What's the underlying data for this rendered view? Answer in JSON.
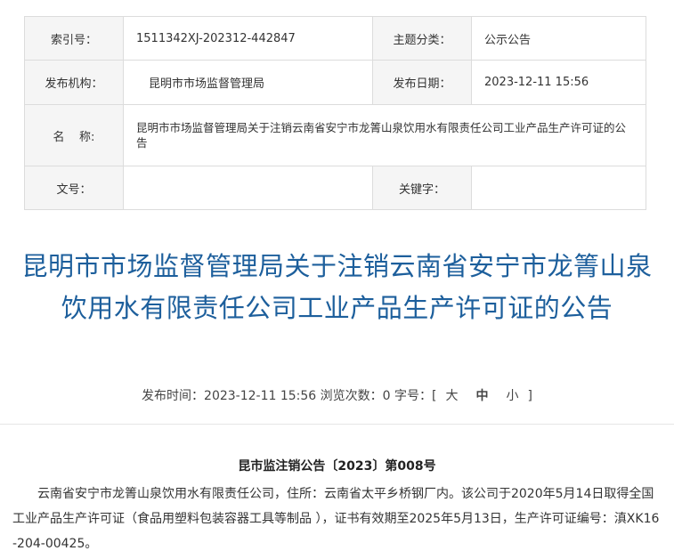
{
  "meta": {
    "index_label": "索引号：",
    "index_value": "1511342XJ-202312-442847",
    "category_label": "主题分类：",
    "category_value": "公示公告",
    "publisher_label": "发布机构：",
    "publisher_value": "昆明市市场监督管理局",
    "date_label": "发布日期：",
    "date_value": "2023-12-11 15:56",
    "name_label": "名    称:",
    "name_value": "昆明市市场监督管理局关于注销云南省安宁市龙箐山泉饮用水有限责任公司工业产品生产许可证的公告",
    "docno_label": "文号：",
    "docno_value": "",
    "keyword_label": "关键字：",
    "keyword_value": ""
  },
  "article": {
    "title": "昆明市市场监督管理局关于注销云南省安宁市龙箐山泉饮用水有限责任公司工业产品生产许可证的公告",
    "publish_time_label": "发布时间：",
    "publish_time": "2023-12-11 15:56",
    "views_label": "浏览次数：",
    "views": "0",
    "fontsize_label": "字号：[",
    "fontsize_large": "大",
    "fontsize_medium": "中",
    "fontsize_small": "小",
    "fontsize_close": "]",
    "doc_number": "昆市监注销公告〔2023〕第008号",
    "paragraph": "云南省安宁市龙箐山泉饮用水有限责任公司，住所：云南省太平乡桥钢厂内。该公司于2020年5月14日取得全国工业产品生产许可证（食品用塑料包装容器工具等制品  ），证书有效期至2025年5月13日，生产许可证编号：滇XK16-204-00425。"
  }
}
